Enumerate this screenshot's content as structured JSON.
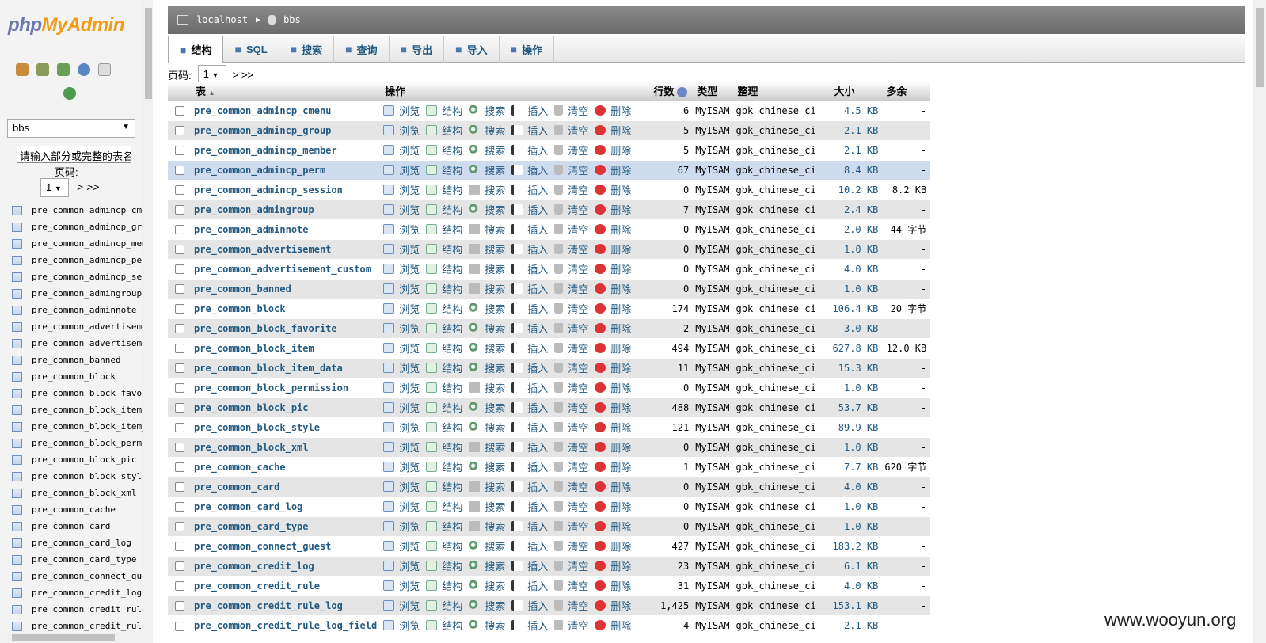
{
  "logo": {
    "php": "php",
    "myadmin": "MyAdmin"
  },
  "sidebar": {
    "db_select": "bbs",
    "filter_placeholder": "请输入部分或完整的表名",
    "page_label": "页码:",
    "page_value": "1",
    "nav": "> >>",
    "tables": [
      "pre_common_admincp_cmenu",
      "pre_common_admincp_group",
      "pre_common_admincp_member",
      "pre_common_admincp_perm",
      "pre_common_admincp_session",
      "pre_common_admingroup",
      "pre_common_adminnote",
      "pre_common_advertisement",
      "pre_common_advertisement_custom",
      "pre_common_banned",
      "pre_common_block",
      "pre_common_block_favorite",
      "pre_common_block_item",
      "pre_common_block_item_data",
      "pre_common_block_permission",
      "pre_common_block_pic",
      "pre_common_block_style",
      "pre_common_block_xml",
      "pre_common_cache",
      "pre_common_card",
      "pre_common_card_log",
      "pre_common_card_type",
      "pre_common_connect_guest",
      "pre_common_credit_log",
      "pre_common_credit_rule",
      "pre_common_credit_rule_log"
    ]
  },
  "breadcrumb": {
    "server": "localhost",
    "db": "bbs"
  },
  "tabs": [
    "结构",
    "SQL",
    "搜索",
    "查询",
    "导出",
    "导入",
    "操作"
  ],
  "pager": {
    "label": "页码:",
    "value": "1",
    "nav": "> >>"
  },
  "table": {
    "headers": {
      "table": "表",
      "action": "操作",
      "rows": "行数",
      "type": "类型",
      "collation": "整理",
      "size": "大小",
      "overhead": "多余"
    },
    "actions": {
      "browse": "浏览",
      "structure": "结构",
      "search": "搜索",
      "insert": "插入",
      "empty": "清空",
      "drop": "删除"
    },
    "rows": [
      {
        "name": "pre_common_admincp_cmenu",
        "rows": "6",
        "engine": "MyISAM",
        "coll": "gbk_chinese_ci",
        "size": "4.5 KB",
        "over": "-"
      },
      {
        "name": "pre_common_admincp_group",
        "rows": "5",
        "engine": "MyISAM",
        "coll": "gbk_chinese_ci",
        "size": "2.1 KB",
        "over": "-"
      },
      {
        "name": "pre_common_admincp_member",
        "rows": "5",
        "engine": "MyISAM",
        "coll": "gbk_chinese_ci",
        "size": "2.1 KB",
        "over": "-"
      },
      {
        "name": "pre_common_admincp_perm",
        "rows": "67",
        "engine": "MyISAM",
        "coll": "gbk_chinese_ci",
        "size": "8.4 KB",
        "over": "-"
      },
      {
        "name": "pre_common_admincp_session",
        "rows": "0",
        "engine": "MyISAM",
        "coll": "gbk_chinese_ci",
        "size": "10.2 KB",
        "over": "8.2 KB"
      },
      {
        "name": "pre_common_admingroup",
        "rows": "7",
        "engine": "MyISAM",
        "coll": "gbk_chinese_ci",
        "size": "2.4 KB",
        "over": "-"
      },
      {
        "name": "pre_common_adminnote",
        "rows": "0",
        "engine": "MyISAM",
        "coll": "gbk_chinese_ci",
        "size": "2.0 KB",
        "over": "44 字节"
      },
      {
        "name": "pre_common_advertisement",
        "rows": "0",
        "engine": "MyISAM",
        "coll": "gbk_chinese_ci",
        "size": "1.0 KB",
        "over": "-"
      },
      {
        "name": "pre_common_advertisement_custom",
        "rows": "0",
        "engine": "MyISAM",
        "coll": "gbk_chinese_ci",
        "size": "4.0 KB",
        "over": "-"
      },
      {
        "name": "pre_common_banned",
        "rows": "0",
        "engine": "MyISAM",
        "coll": "gbk_chinese_ci",
        "size": "1.0 KB",
        "over": "-"
      },
      {
        "name": "pre_common_block",
        "rows": "174",
        "engine": "MyISAM",
        "coll": "gbk_chinese_ci",
        "size": "106.4 KB",
        "over": "20 字节"
      },
      {
        "name": "pre_common_block_favorite",
        "rows": "2",
        "engine": "MyISAM",
        "coll": "gbk_chinese_ci",
        "size": "3.0 KB",
        "over": "-"
      },
      {
        "name": "pre_common_block_item",
        "rows": "494",
        "engine": "MyISAM",
        "coll": "gbk_chinese_ci",
        "size": "627.8 KB",
        "over": "12.0 KB"
      },
      {
        "name": "pre_common_block_item_data",
        "rows": "11",
        "engine": "MyISAM",
        "coll": "gbk_chinese_ci",
        "size": "15.3 KB",
        "over": "-"
      },
      {
        "name": "pre_common_block_permission",
        "rows": "0",
        "engine": "MyISAM",
        "coll": "gbk_chinese_ci",
        "size": "1.0 KB",
        "over": "-"
      },
      {
        "name": "pre_common_block_pic",
        "rows": "488",
        "engine": "MyISAM",
        "coll": "gbk_chinese_ci",
        "size": "53.7 KB",
        "over": "-"
      },
      {
        "name": "pre_common_block_style",
        "rows": "121",
        "engine": "MyISAM",
        "coll": "gbk_chinese_ci",
        "size": "89.9 KB",
        "over": "-"
      },
      {
        "name": "pre_common_block_xml",
        "rows": "0",
        "engine": "MyISAM",
        "coll": "gbk_chinese_ci",
        "size": "1.0 KB",
        "over": "-"
      },
      {
        "name": "pre_common_cache",
        "rows": "1",
        "engine": "MyISAM",
        "coll": "gbk_chinese_ci",
        "size": "7.7 KB",
        "over": "620 字节"
      },
      {
        "name": "pre_common_card",
        "rows": "0",
        "engine": "MyISAM",
        "coll": "gbk_chinese_ci",
        "size": "4.0 KB",
        "over": "-"
      },
      {
        "name": "pre_common_card_log",
        "rows": "0",
        "engine": "MyISAM",
        "coll": "gbk_chinese_ci",
        "size": "1.0 KB",
        "over": "-"
      },
      {
        "name": "pre_common_card_type",
        "rows": "0",
        "engine": "MyISAM",
        "coll": "gbk_chinese_ci",
        "size": "1.0 KB",
        "over": "-"
      },
      {
        "name": "pre_common_connect_guest",
        "rows": "427",
        "engine": "MyISAM",
        "coll": "gbk_chinese_ci",
        "size": "183.2 KB",
        "over": "-"
      },
      {
        "name": "pre_common_credit_log",
        "rows": "23",
        "engine": "MyISAM",
        "coll": "gbk_chinese_ci",
        "size": "6.1 KB",
        "over": "-"
      },
      {
        "name": "pre_common_credit_rule",
        "rows": "31",
        "engine": "MyISAM",
        "coll": "gbk_chinese_ci",
        "size": "4.0 KB",
        "over": "-"
      },
      {
        "name": "pre_common_credit_rule_log",
        "rows": "1,425",
        "engine": "MyISAM",
        "coll": "gbk_chinese_ci",
        "size": "153.1 KB",
        "over": "-"
      },
      {
        "name": "pre_common_credit_rule_log_field",
        "rows": "4",
        "engine": "MyISAM",
        "coll": "gbk_chinese_ci",
        "size": "2.1 KB",
        "over": "-"
      }
    ]
  },
  "watermark": "www.wooyun.org"
}
